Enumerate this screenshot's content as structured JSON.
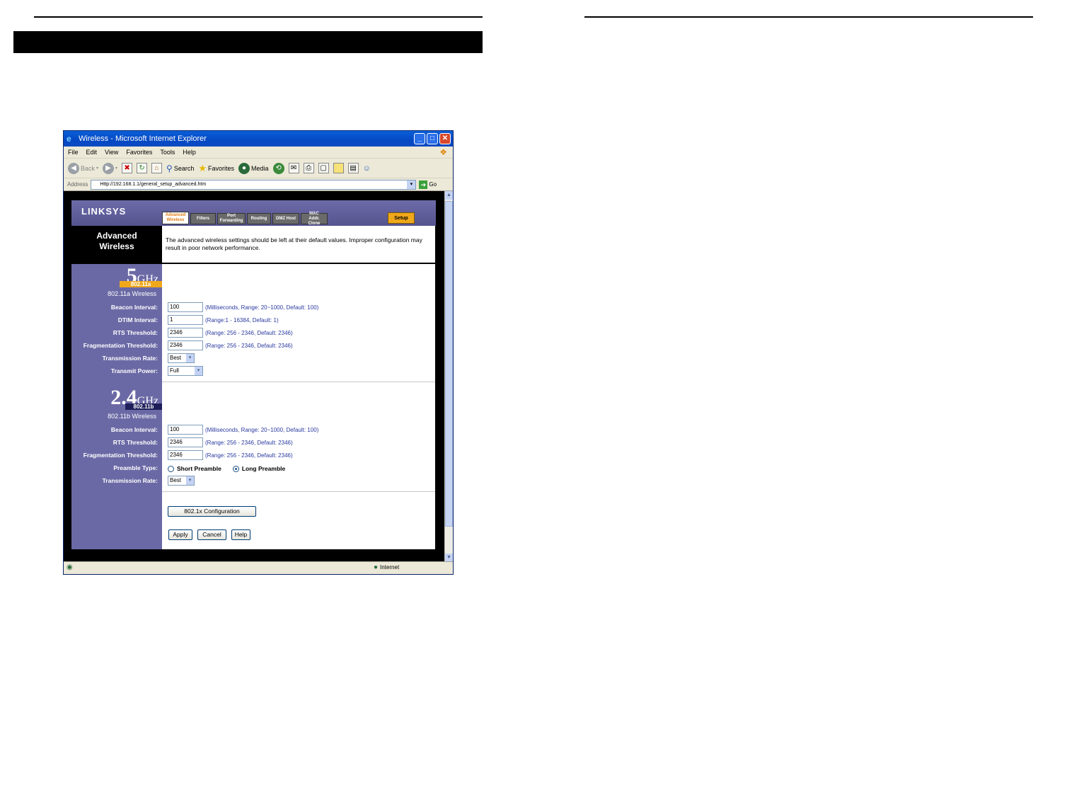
{
  "browser": {
    "title": "Wireless - Microsoft Internet Explorer",
    "menu": [
      "File",
      "Edit",
      "View",
      "Favorites",
      "Tools",
      "Help"
    ],
    "toolbar": {
      "back": "Back",
      "search": "Search",
      "favorites": "Favorites",
      "media": "Media"
    },
    "address_label": "Address",
    "address": "Http://192.168.1.1/general_setup_advanced.htm",
    "go": "Go",
    "status_zone": "Internet"
  },
  "linksys": {
    "logo": "LINKSYS",
    "tabs": [
      {
        "label": "Advanced Wireless",
        "active": true
      },
      {
        "label": "Filters"
      },
      {
        "label": "Port Forwarding"
      },
      {
        "label": "Routing"
      },
      {
        "label": "DMZ Host"
      },
      {
        "label": "MAC Addr. Clone"
      }
    ],
    "setup_tab": "Setup",
    "section_title": "Advanced Wireless",
    "intro": "The advanced wireless settings should be left at their default values. Improper configuration may result in poor network performance.",
    "a": {
      "band_big": "5",
      "band_ghz": "GHz",
      "band_tag": "802.11a",
      "subtitle": "802.11a Wireless",
      "beacon_label": "Beacon Interval:",
      "beacon_value": "100",
      "beacon_hint": "(Milliseconds, Range: 20~1000, Default: 100)",
      "dtim_label": "DTIM Interval:",
      "dtim_value": "1",
      "dtim_hint": "(Range:1 - 16384, Default: 1)",
      "rts_label": "RTS Threshold:",
      "rts_value": "2346",
      "rts_hint": "(Range: 256 - 2346, Default: 2346)",
      "frag_label": "Fragmentation Threshold:",
      "frag_value": "2346",
      "frag_hint": "(Range: 256 - 2346, Default: 2346)",
      "rate_label": "Transmission Rate:",
      "rate_value": "Best",
      "power_label": "Transmit Power:",
      "power_value": "Full"
    },
    "b": {
      "band_big": "2.4",
      "band_ghz": "GHz",
      "band_tag": "802.11b",
      "subtitle": "802.11b Wireless",
      "beacon_label": "Beacon Interval:",
      "beacon_value": "100",
      "beacon_hint": "(Milliseconds, Range: 20~1000, Default: 100)",
      "rts_label": "RTS Threshold:",
      "rts_value": "2346",
      "rts_hint": "(Range: 256 - 2346, Default: 2346)",
      "frag_label": "Fragmentation Threshold:",
      "frag_value": "2346",
      "frag_hint": "(Range: 256 - 2346, Default: 2346)",
      "preamble_label": "Preamble Type:",
      "preamble_short": "Short Preamble",
      "preamble_long": "Long Preamble",
      "preamble_selected": "long",
      "rate_label": "Transmission Rate:",
      "rate_value": "Best"
    },
    "config_button": "802.1x Configuration",
    "apply": "Apply",
    "cancel": "Cancel",
    "help": "Help"
  },
  "colors": {
    "side_purple": "#6b69a5",
    "tab_active": "#e07a10",
    "setup_tab": "#f0a81a",
    "hint_blue": "#2a3aa0",
    "band_a_tag": "#f0a81a",
    "band_b_tag": "#1e1e5a"
  }
}
